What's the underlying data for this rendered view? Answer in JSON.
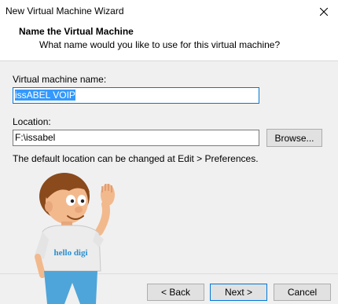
{
  "window": {
    "title": "New Virtual Machine Wizard"
  },
  "header": {
    "title": "Name the Virtual Machine",
    "subtitle": "What name would you like to use for this virtual machine?"
  },
  "form": {
    "vm_name_label": "Virtual machine name:",
    "vm_name_value": "issABEL VOIP",
    "location_label": "Location:",
    "location_value": "F:\\issabel",
    "browse_label": "Browse...",
    "hint": "The default location can be changed at Edit > Preferences."
  },
  "mascot": {
    "shirt_text": "hello digi"
  },
  "footer": {
    "back_label": "< Back",
    "next_label": "Next >",
    "cancel_label": "Cancel"
  },
  "colors": {
    "selection": "#3399ff",
    "focus_border": "#0078d7",
    "dialog_bg": "#f0f0f0"
  },
  "icons": {
    "close": "close-icon"
  }
}
